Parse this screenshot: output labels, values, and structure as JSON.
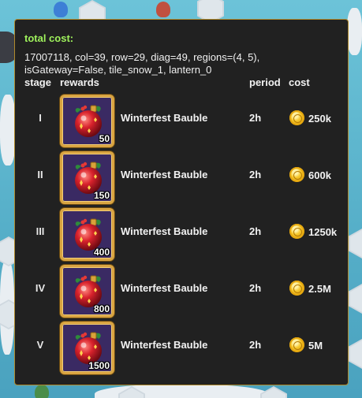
{
  "tooltip": {
    "total_cost_label": "total cost:",
    "info_line1": "17007118, col=39, row=29, diag=49, regions=(4, 5),",
    "info_line2": "isGateway=False, tile_snow_1, lantern_0",
    "headers": {
      "stage": "stage",
      "rewards": "rewards",
      "period": "period",
      "cost": "cost"
    },
    "rows": [
      {
        "stage": "I",
        "reward_name": "Winterfest Bauble",
        "quantity": "50",
        "period": "2h",
        "cost": "250k",
        "icon": "winterfest-bauble-icon"
      },
      {
        "stage": "II",
        "reward_name": "Winterfest Bauble",
        "quantity": "150",
        "period": "2h",
        "cost": "600k",
        "icon": "winterfest-bauble-icon"
      },
      {
        "stage": "III",
        "reward_name": "Winterfest Bauble",
        "quantity": "400",
        "period": "2h",
        "cost": "1250k",
        "icon": "winterfest-bauble-icon"
      },
      {
        "stage": "IV",
        "reward_name": "Winterfest Bauble",
        "quantity": "800",
        "period": "2h",
        "cost": "2.5M",
        "icon": "winterfest-bauble-icon"
      },
      {
        "stage": "V",
        "reward_name": "Winterfest Bauble",
        "quantity": "1500",
        "period": "2h",
        "cost": "5M",
        "icon": "winterfest-bauble-icon"
      }
    ]
  },
  "colors": {
    "panel_bg": "#212121",
    "panel_border": "#b08a2c",
    "total_label": "#9ff25c",
    "slot_frame": "#d9a441",
    "slot_bg": "#3a2a63",
    "coin": "#f6c72b"
  }
}
